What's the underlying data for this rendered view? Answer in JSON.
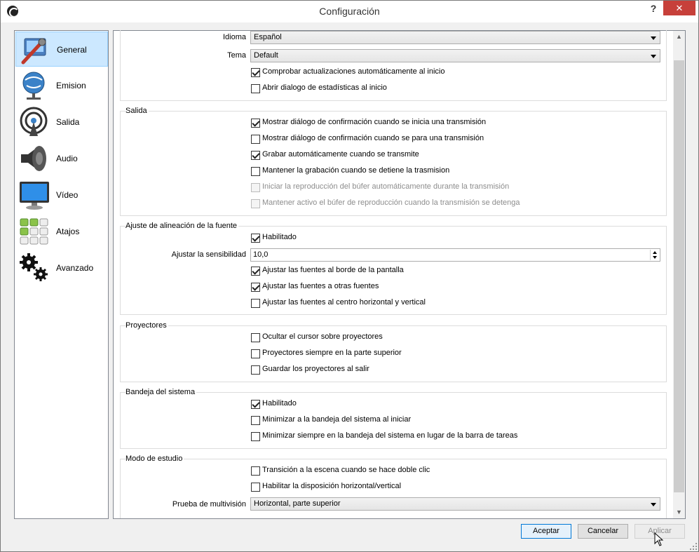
{
  "window": {
    "title": "Configuración",
    "help_label": "?",
    "close_label": "✕"
  },
  "sidebar": {
    "items": [
      {
        "label": "General",
        "icon": "general-icon",
        "selected": true
      },
      {
        "label": "Emision",
        "icon": "broadcast-icon"
      },
      {
        "label": "Salida",
        "icon": "output-icon"
      },
      {
        "label": "Audio",
        "icon": "speaker-icon"
      },
      {
        "label": "Vídeo",
        "icon": "monitor-icon"
      },
      {
        "label": "Atajos",
        "icon": "hotkeys-icon"
      },
      {
        "label": "Avanzado",
        "icon": "gears-icon"
      }
    ]
  },
  "general": {
    "language_label": "Idioma",
    "language_value": "Español",
    "theme_label": "Tema",
    "theme_value": "Default",
    "check_updates": {
      "label": "Comprobar actualizaciones automáticamente al inicio",
      "checked": true
    },
    "stats_dialog": {
      "label": "Abrir dialogo de estadísticas al inicio",
      "checked": false
    }
  },
  "output": {
    "title": "Salida",
    "items": [
      {
        "label": "Mostrar diálogo de confirmación cuando se inicia una transmisión",
        "checked": true,
        "enabled": true
      },
      {
        "label": "Mostrar diálogo de confirmación cuando se para una transmisión",
        "checked": false,
        "enabled": true
      },
      {
        "label": "Grabar automáticamente cuando se transmite",
        "checked": true,
        "enabled": true
      },
      {
        "label": "Mantener la grabación cuando se detiene la trasmision",
        "checked": false,
        "enabled": true
      },
      {
        "label": "Iniciar la reproducción del búfer automáticamente durante la transmisión",
        "checked": false,
        "enabled": false
      },
      {
        "label": "Mantener activo el búfer de reproducción cuando la transmisión se detenga",
        "checked": false,
        "enabled": false
      }
    ]
  },
  "snapping": {
    "title": "Ajuste de alineación de la fuente",
    "enabled": {
      "label": "Habilitado",
      "checked": true
    },
    "sensitivity_label": "Ajustar la sensibilidad",
    "sensitivity_value": "10,0",
    "items": [
      {
        "label": "Ajustar las fuentes al borde de la pantalla",
        "checked": true
      },
      {
        "label": "Ajustar las fuentes a otras fuentes",
        "checked": true
      },
      {
        "label": "Ajustar las fuentes al centro horizontal y vertical",
        "checked": false
      }
    ]
  },
  "projectors": {
    "title": "Proyectores",
    "items": [
      {
        "label": "Ocultar el cursor sobre proyectores",
        "checked": false
      },
      {
        "label": "Proyectores siempre en la parte superior",
        "checked": false
      },
      {
        "label": "Guardar los proyectores al salir",
        "checked": false
      }
    ]
  },
  "tray": {
    "title": "Bandeja del sistema",
    "items": [
      {
        "label": "Habilitado",
        "checked": true
      },
      {
        "label": "Minimizar a la bandeja del sistema al iniciar",
        "checked": false
      },
      {
        "label": "Minimizar siempre en la bandeja del sistema en lugar de la barra de tareas",
        "checked": false
      }
    ]
  },
  "studio": {
    "title": "Modo de estudio",
    "items": [
      {
        "label": "Transición a la escena cuando se hace doble clic",
        "checked": false
      },
      {
        "label": "Habilitar la disposición horizontal/vertical",
        "checked": false
      }
    ],
    "multiview_label": "Prueba de multivisión",
    "multiview_value": "Horizontal, parte superior"
  },
  "buttons": {
    "ok": "Aceptar",
    "cancel": "Cancelar",
    "apply": "Aplicar"
  }
}
